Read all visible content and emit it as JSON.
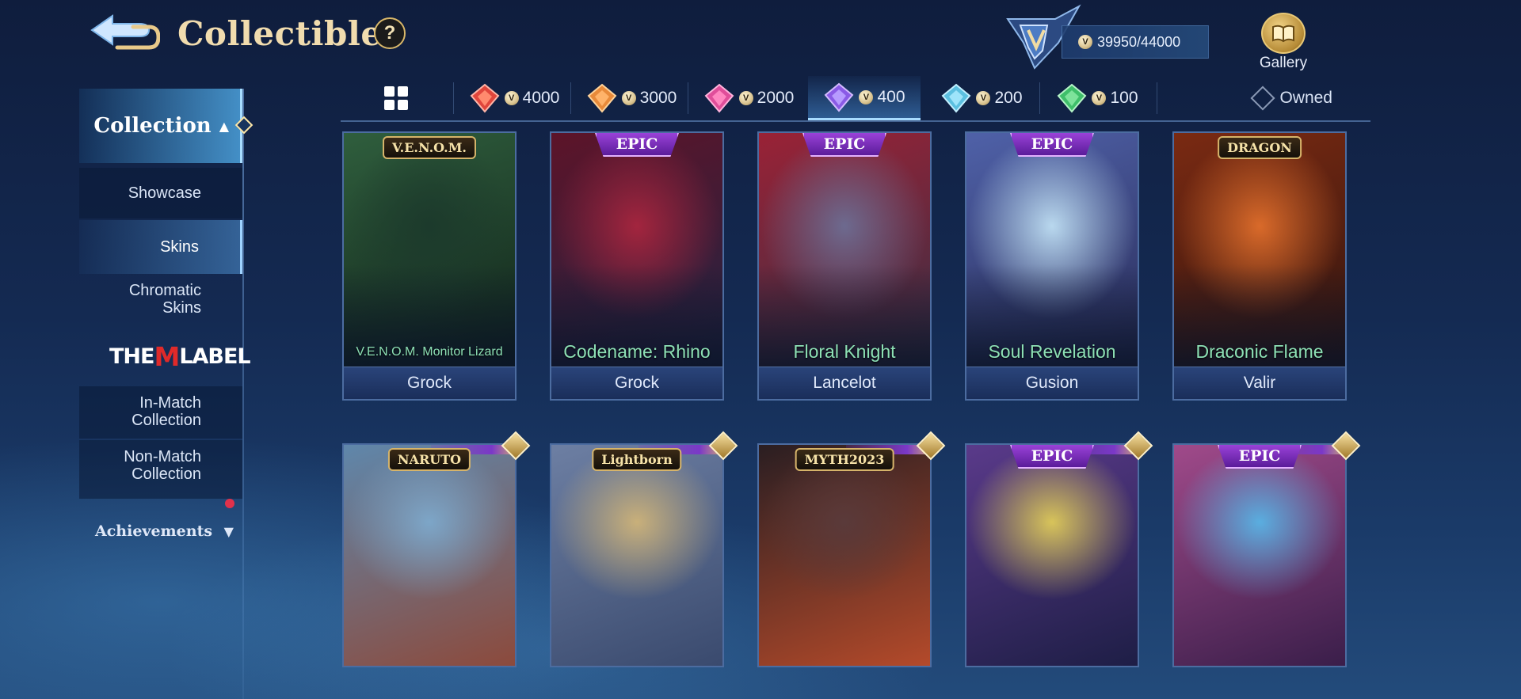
{
  "header": {
    "title": "Collectible",
    "help_label": "?",
    "points": "39950/44000",
    "gallery_label": "Gallery"
  },
  "sidebar": {
    "collection_label": "Collection",
    "items": {
      "showcase": "Showcase",
      "skins": "Skins",
      "chromatic_1": "Chromatic",
      "chromatic_2": "Skins",
      "mlabel_the": "THE",
      "mlabel_m": "M",
      "mlabel_label": "LABEL",
      "inmatch_1": "In-Match",
      "inmatch_2": "Collection",
      "nonmatch_1": "Non-Match",
      "nonmatch_2": "Collection"
    },
    "achievements_label": "Achievements",
    "active_item": "Skins"
  },
  "tabs": [
    {
      "id": "all",
      "label": "",
      "icon": "grid-icon"
    },
    {
      "id": "tier-4000",
      "label": "4000",
      "color": "#e0463c"
    },
    {
      "id": "tier-3000",
      "label": "3000",
      "color": "#e88a3a"
    },
    {
      "id": "tier-2000",
      "label": "2000",
      "color": "#e04e9a"
    },
    {
      "id": "tier-400",
      "label": "400",
      "color": "#8a5ae6",
      "active": true
    },
    {
      "id": "tier-200",
      "label": "200",
      "color": "#5cc0e0"
    },
    {
      "id": "tier-100",
      "label": "100",
      "color": "#3fbf6a"
    }
  ],
  "owned_label": "Owned",
  "cards": [
    {
      "skin": "V.E.N.O.M. Monitor Lizard",
      "hero": "Grock",
      "badge": "V.E.N.O.M.",
      "badge_type": "logo",
      "art": [
        "#1c3a2c",
        "#2f5e3d",
        "#0e1d16"
      ]
    },
    {
      "skin": "Codename: Rhino",
      "hero": "Grock",
      "badge": "EPIC",
      "badge_type": "epic",
      "art": [
        "#a3253e",
        "#5d1429",
        "#1b2546"
      ]
    },
    {
      "skin": "Floral Knight",
      "hero": "Lancelot",
      "badge": "EPIC",
      "badge_type": "epic",
      "art": [
        "#6d6a8f",
        "#9a2236",
        "#2d3046"
      ]
    },
    {
      "skin": "Soul Revelation",
      "hero": "Gusion",
      "badge": "EPIC",
      "badge_type": "epic",
      "art": [
        "#b9d8ee",
        "#4f61a8",
        "#25264f"
      ]
    },
    {
      "skin": "Draconic Flame",
      "hero": "Valir",
      "badge": "DRAGON",
      "badge_type": "logo",
      "art": [
        "#d96a2a",
        "#7a2a12",
        "#2a120e"
      ]
    },
    {
      "skin": "",
      "hero": "",
      "badge": "NARUTO",
      "badge_type": "logo",
      "art": [
        "#7da6c8",
        "#5f87ab",
        "#8c4a3c"
      ]
    },
    {
      "skin": "",
      "hero": "",
      "badge": "Lightborn",
      "badge_type": "logo",
      "art": [
        "#c9b07a",
        "#6d7fa3",
        "#3a4a6e"
      ]
    },
    {
      "skin": "",
      "hero": "",
      "badge": "MYTH2023",
      "badge_type": "logo",
      "art": [
        "#5a3a3a",
        "#2a1e22",
        "#b44a2a"
      ]
    },
    {
      "skin": "",
      "hero": "",
      "badge": "EPIC",
      "badge_type": "epic",
      "art": [
        "#d8c45a",
        "#5a3a8a",
        "#1e1e46"
      ]
    },
    {
      "skin": "",
      "hero": "",
      "badge": "EPIC",
      "badge_type": "epic",
      "art": [
        "#5aaee0",
        "#a04a8a",
        "#3a1e4a"
      ]
    }
  ]
}
